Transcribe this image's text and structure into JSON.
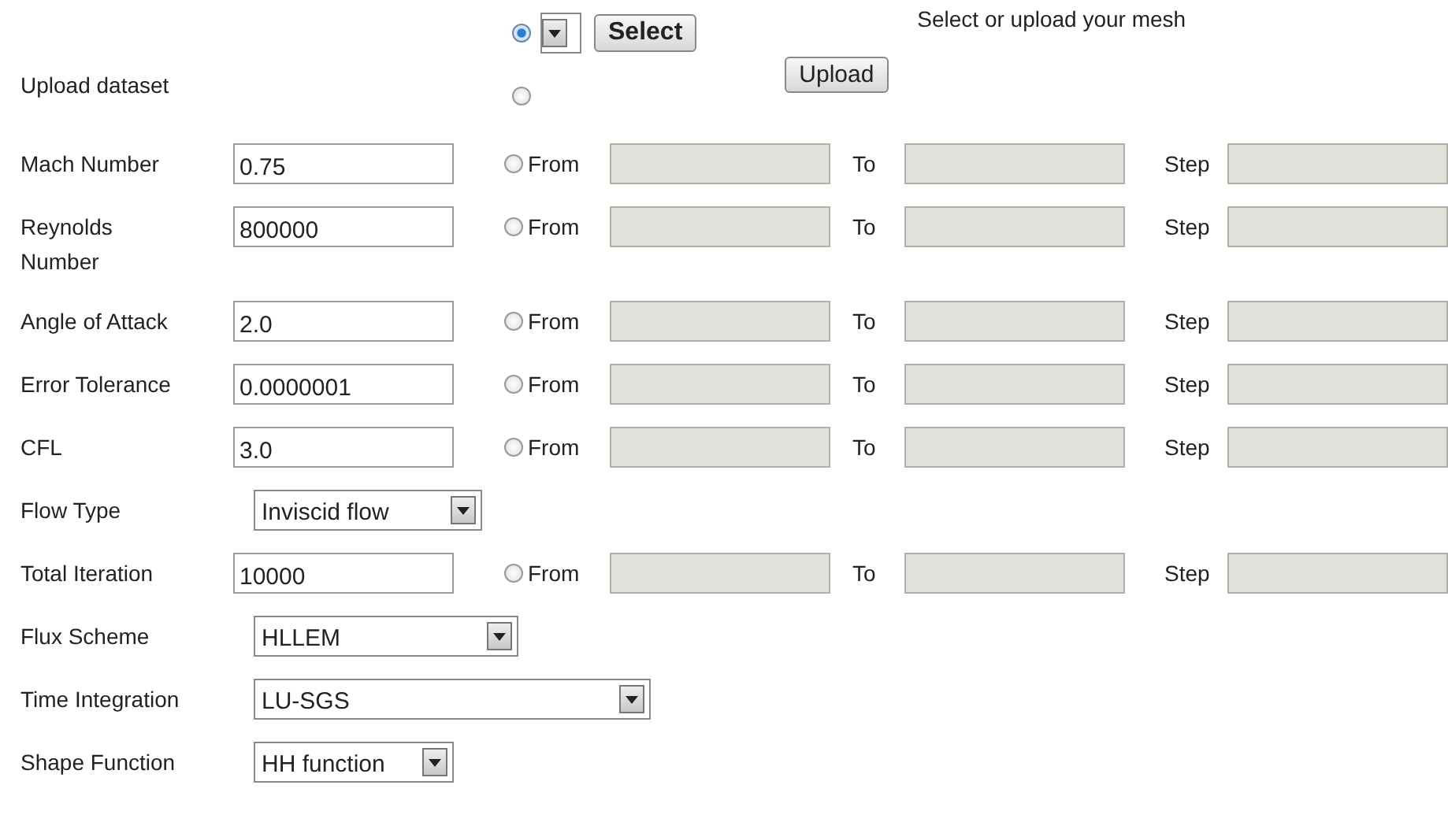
{
  "upload": {
    "label": "Upload dataset",
    "hint": "Select or upload your mesh",
    "select_button": "Select",
    "upload_button": "Upload",
    "options": [
      {
        "kind": "select",
        "selected": true
      },
      {
        "kind": "file",
        "selected": false
      }
    ]
  },
  "params": [
    {
      "label": "Mach Number",
      "kind": "text",
      "value": "0.75",
      "range": {
        "selected": false,
        "disabled": true,
        "from": "From",
        "to": "To",
        "step": "Step"
      }
    },
    {
      "label": "Reynolds Number",
      "kind": "text",
      "value": "800000",
      "range": {
        "selected": false,
        "disabled": true,
        "from": "From",
        "to": "To",
        "step": "Step"
      }
    },
    {
      "label": "Angle of Attack",
      "kind": "text",
      "value": "2.0",
      "range": {
        "selected": false,
        "disabled": true,
        "from": "From",
        "to": "To",
        "step": "Step"
      }
    },
    {
      "label": "Error Tolerance",
      "kind": "text",
      "value": "0.0000001",
      "range": {
        "selected": false,
        "disabled": true,
        "from": "From",
        "to": "To",
        "step": "Step"
      }
    },
    {
      "label": "CFL",
      "kind": "text",
      "value": "3.0",
      "range": {
        "selected": false,
        "disabled": true,
        "from": "From",
        "to": "To",
        "step": "Step"
      }
    },
    {
      "label": "Flow Type",
      "kind": "select",
      "value": "Inviscid flow"
    },
    {
      "label": "Total Iteration",
      "kind": "text",
      "value": "10000",
      "range": {
        "selected": false,
        "disabled": true,
        "from": "From",
        "to": "To",
        "step": "Step"
      }
    },
    {
      "label": "Flux Scheme",
      "kind": "select",
      "value": "HLLEM"
    },
    {
      "label": "Time Integration",
      "kind": "select",
      "value": "LU-SGS"
    },
    {
      "label": "Shape Function",
      "kind": "select",
      "value": "HH function"
    }
  ]
}
